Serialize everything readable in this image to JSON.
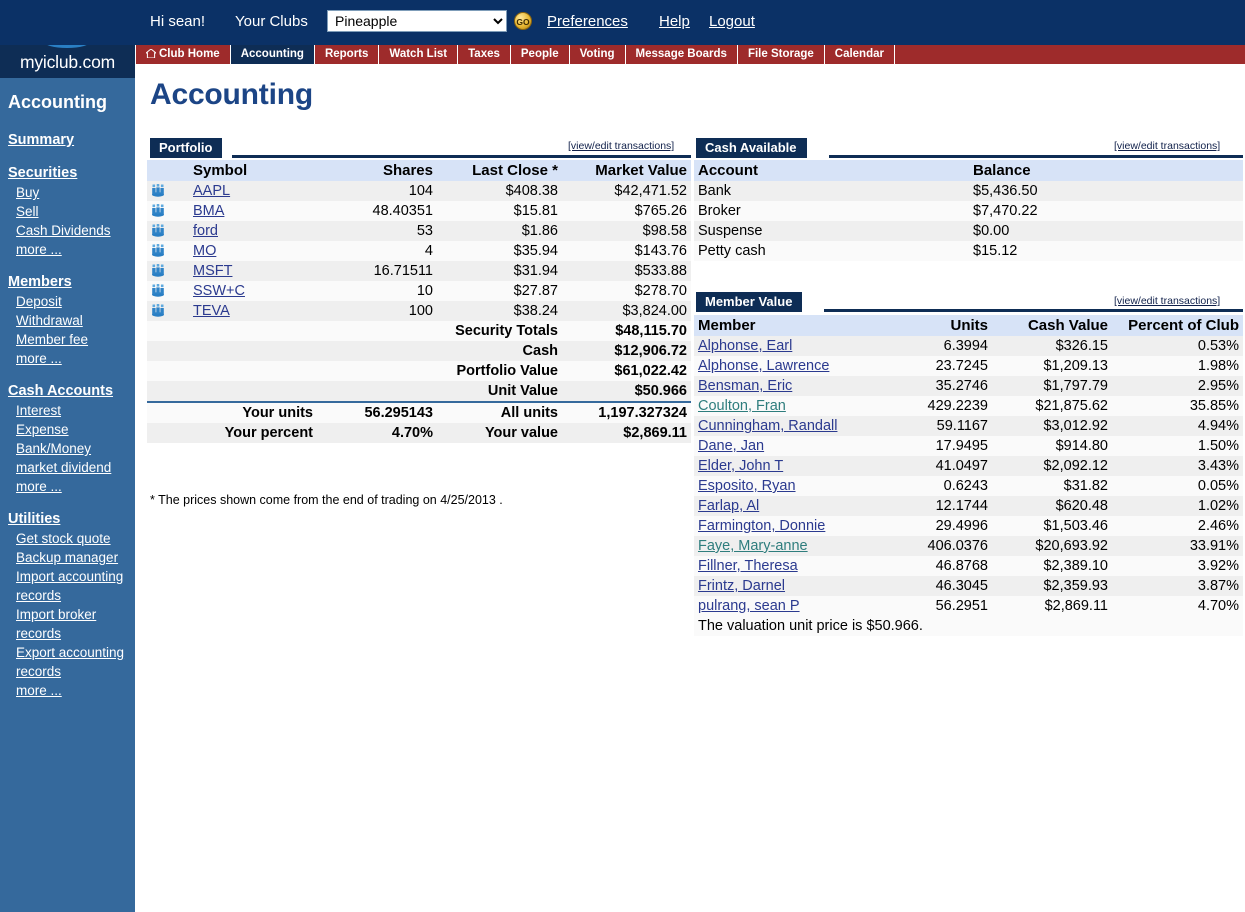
{
  "brand": {
    "name": "myiclub.com",
    "logo_icon": "people-group-logo"
  },
  "header": {
    "greeting": "Hi sean!",
    "your_clubs_label": "Your Clubs",
    "club_select_value": "Pineapple",
    "club_options": [
      "Pineapple"
    ],
    "go_label": "GO",
    "links": [
      {
        "label": "Preferences",
        "name": "preferences-link"
      },
      {
        "label": "Help",
        "name": "help-link"
      },
      {
        "label": "Logout",
        "name": "logout-link"
      }
    ]
  },
  "tabs": [
    {
      "label": "Club Home",
      "icon": "home-icon",
      "active": false
    },
    {
      "label": "Accounting",
      "active": true
    },
    {
      "label": "Reports",
      "active": false
    },
    {
      "label": "Watch List",
      "active": false
    },
    {
      "label": "Taxes",
      "active": false
    },
    {
      "label": "People",
      "active": false
    },
    {
      "label": "Voting",
      "active": false
    },
    {
      "label": "Message Boards",
      "active": false
    },
    {
      "label": "File Storage",
      "active": false
    },
    {
      "label": "Calendar",
      "active": false
    }
  ],
  "page": {
    "title": "Accounting"
  },
  "sidebar": {
    "title": "Accounting",
    "groups": [
      {
        "head": "Summary",
        "items": []
      },
      {
        "head": "Securities",
        "items": [
          "Buy",
          "Sell",
          "Cash Dividends",
          "more ..."
        ]
      },
      {
        "head": "Members",
        "items": [
          "Deposit",
          "Withdrawal",
          "Member fee",
          "more ..."
        ]
      },
      {
        "head": "Cash Accounts",
        "items": [
          "Interest",
          "Expense",
          "Bank/Money market dividend",
          "more ..."
        ]
      },
      {
        "head": "Utilities",
        "items": [
          "Get stock quote",
          "Backup manager",
          "Import accounting records",
          "Import broker records",
          "Export accounting records",
          "more ..."
        ]
      }
    ]
  },
  "portfolio": {
    "tab_label": "Portfolio",
    "view_edit_label": "[view/edit transactions]",
    "columns": [
      "Symbol",
      "Shares",
      "Last Close *",
      "Market Value"
    ],
    "rows": [
      {
        "symbol": "AAPL",
        "shares": "104",
        "last_close": "$408.38",
        "market_value": "$42,471.52"
      },
      {
        "symbol": "BMA",
        "shares": "48.40351",
        "last_close": "$15.81",
        "market_value": "$765.26"
      },
      {
        "symbol": "ford",
        "shares": "53",
        "last_close": "$1.86",
        "market_value": "$98.58"
      },
      {
        "symbol": "MO",
        "shares": "4",
        "last_close": "$35.94",
        "market_value": "$143.76"
      },
      {
        "symbol": "MSFT",
        "shares": "16.71511",
        "last_close": "$31.94",
        "market_value": "$533.88"
      },
      {
        "symbol": "SSW+C",
        "shares": "10",
        "last_close": "$27.87",
        "market_value": "$278.70"
      },
      {
        "symbol": "TEVA",
        "shares": "100",
        "last_close": "$38.24",
        "market_value": "$3,824.00"
      }
    ],
    "totals": [
      {
        "label": "Security Totals",
        "value": "$48,115.70"
      },
      {
        "label": "Cash",
        "value": "$12,906.72"
      },
      {
        "label": "Portfolio Value",
        "value": "$61,022.42"
      },
      {
        "label": "Unit Value",
        "value": "$50.966"
      }
    ],
    "your_units_label": "Your units",
    "your_units_value": "56.295143",
    "all_units_label": "All units",
    "all_units_value": "1,197.327324",
    "your_percent_label": "Your percent",
    "your_percent_value": "4.70%",
    "your_value_label": "Your value",
    "your_value_value": "$2,869.11",
    "footnote": "* The prices shown come from the end of trading on 4/25/2013 ."
  },
  "cash_available": {
    "tab_label": "Cash Available",
    "view_edit_label": "[view/edit transactions]",
    "columns": [
      "Account",
      "Balance"
    ],
    "rows": [
      {
        "account": "Bank",
        "balance": "$5,436.50"
      },
      {
        "account": "Broker",
        "balance": "$7,470.22"
      },
      {
        "account": "Suspense",
        "balance": "$0.00"
      },
      {
        "account": "Petty cash",
        "balance": "$15.12"
      }
    ]
  },
  "member_value": {
    "tab_label": "Member Value",
    "view_edit_label": "[view/edit transactions]",
    "columns": [
      "Member",
      "Units",
      "Cash Value",
      "Percent of Club"
    ],
    "rows": [
      {
        "member": "Alphonse, Earl",
        "units": "6.3994",
        "cash_value": "$326.15",
        "percent": "0.53%",
        "visited": false
      },
      {
        "member": "Alphonse, Lawrence",
        "units": "23.7245",
        "cash_value": "$1,209.13",
        "percent": "1.98%",
        "visited": false
      },
      {
        "member": "Bensman, Eric",
        "units": "35.2746",
        "cash_value": "$1,797.79",
        "percent": "2.95%",
        "visited": false
      },
      {
        "member": "Coulton, Fran",
        "units": "429.2239",
        "cash_value": "$21,875.62",
        "percent": "35.85%",
        "visited": true
      },
      {
        "member": "Cunningham, Randall",
        "units": "59.1167",
        "cash_value": "$3,012.92",
        "percent": "4.94%",
        "visited": false
      },
      {
        "member": "Dane, Jan",
        "units": "17.9495",
        "cash_value": "$914.80",
        "percent": "1.50%",
        "visited": false
      },
      {
        "member": "Elder, John T",
        "units": "41.0497",
        "cash_value": "$2,092.12",
        "percent": "3.43%",
        "visited": false
      },
      {
        "member": "Esposito, Ryan",
        "units": "0.6243",
        "cash_value": "$31.82",
        "percent": "0.05%",
        "visited": false
      },
      {
        "member": "Farlap, Al",
        "units": "12.1744",
        "cash_value": "$620.48",
        "percent": "1.02%",
        "visited": false
      },
      {
        "member": "Farmington, Donnie",
        "units": "29.4996",
        "cash_value": "$1,503.46",
        "percent": "2.46%",
        "visited": false
      },
      {
        "member": "Faye, Mary-anne",
        "units": "406.0376",
        "cash_value": "$20,693.92",
        "percent": "33.91%",
        "visited": true
      },
      {
        "member": "Fillner, Theresa",
        "units": "46.8768",
        "cash_value": "$2,389.10",
        "percent": "3.92%",
        "visited": false
      },
      {
        "member": "Frintz, Darnel",
        "units": "46.3045",
        "cash_value": "$2,359.93",
        "percent": "3.87%",
        "visited": false
      },
      {
        "member": "pulrang, sean P",
        "units": "56.2951",
        "cash_value": "$2,869.11",
        "percent": "4.70%",
        "visited": false
      }
    ],
    "footer_note": "The valuation unit price is $50.966."
  },
  "colors": {
    "header_blue": "#0b3166",
    "sidebar_blue": "#35699c",
    "panel_navy": "#0e2d55",
    "tab_red": "#9e2b2b",
    "title_blue": "#1c4586",
    "col_header_blue": "#d7e3f7",
    "link_blue": "#2b3a8f",
    "visited_link": "#2e7d7d"
  }
}
